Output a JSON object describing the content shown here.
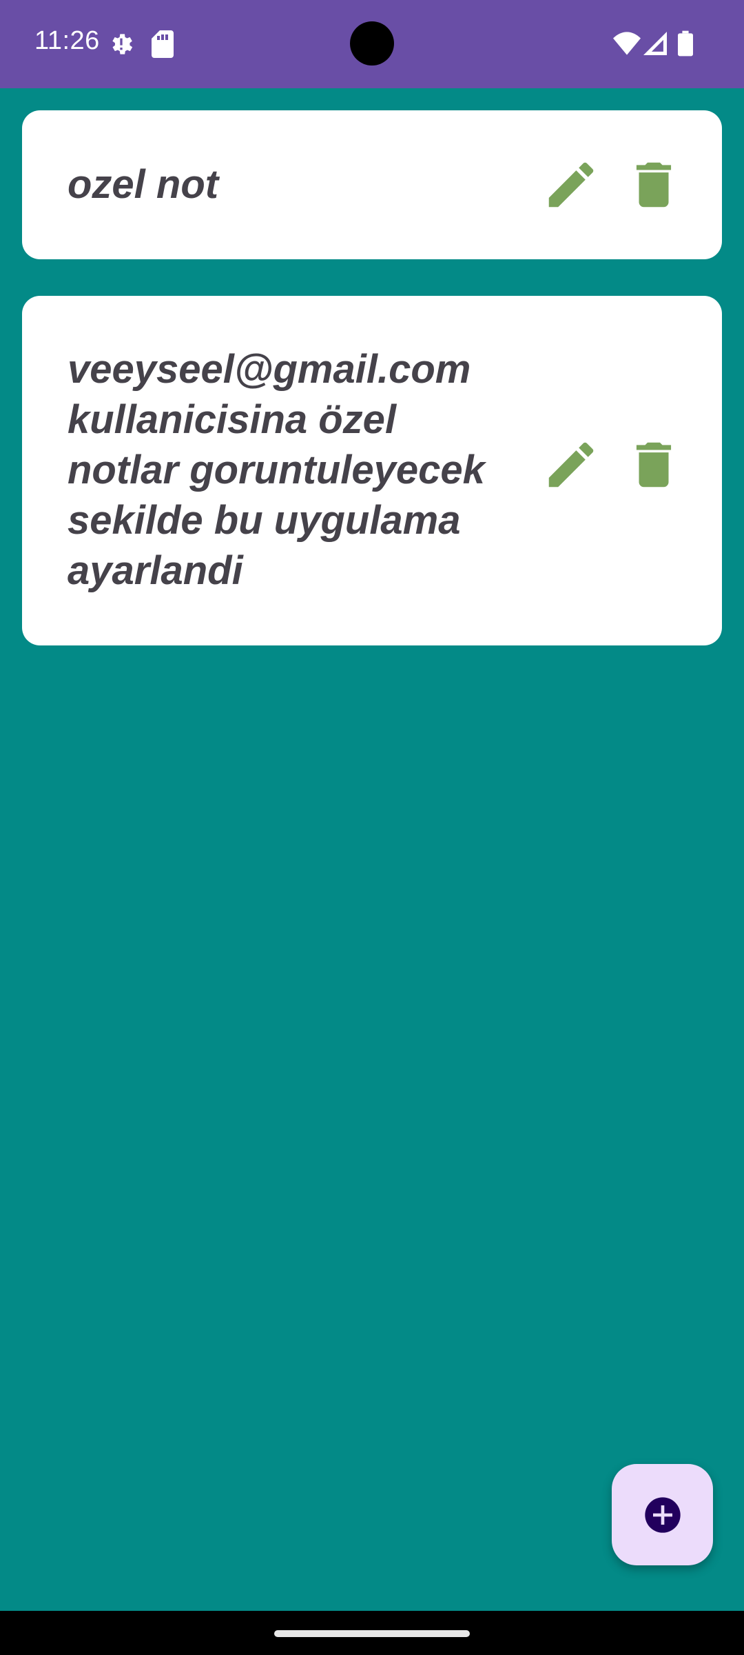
{
  "status_bar": {
    "time": "11:26",
    "icons": [
      "settings-gear-icon",
      "sd-card-icon",
      "wifi-icon",
      "cell-signal-icon",
      "battery-icon"
    ]
  },
  "notes": [
    {
      "text": "ozel not"
    },
    {
      "text": "veeyseel@gmail.com kullanicisina özel notlar goruntuleyecek sekilde bu uygulama ayarlandi"
    }
  ],
  "actions": {
    "edit_icon": "pencil-icon",
    "delete_icon": "trash-icon",
    "fab_icon": "add-circle-icon"
  },
  "colors": {
    "status_bar": "#694ea6",
    "background": "#038a87",
    "card": "#ffffff",
    "note_text": "#45424a",
    "icon_green": "#7aa35a",
    "fab_background": "#ecdcfb",
    "fab_icon": "#22005d"
  }
}
